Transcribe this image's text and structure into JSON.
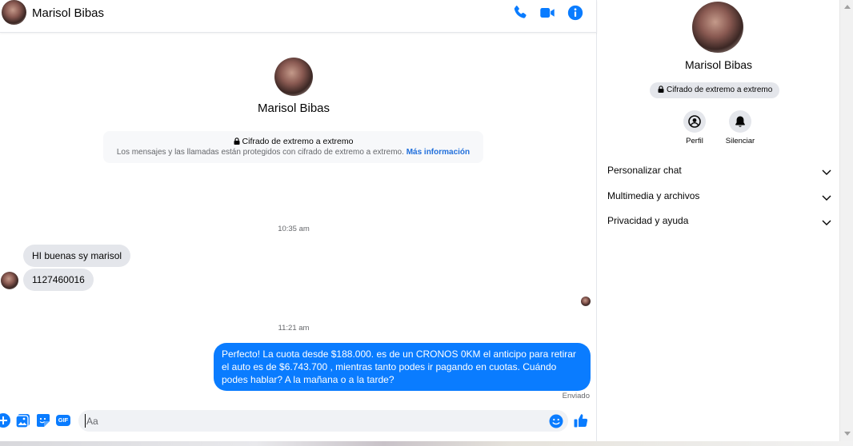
{
  "contact": {
    "name": "Marisol Bibas"
  },
  "header": {
    "icons": [
      "phone-icon",
      "video-camera-icon",
      "info-icon"
    ]
  },
  "intro": {
    "name": "Marisol Bibas",
    "e2ee_title": "Cifrado de extremo a extremo",
    "e2ee_text": "Los mensajes y las llamadas están protegidos con cifrado de extremo a extremo.",
    "e2ee_link": "Más información"
  },
  "messages": {
    "time1": "10:35 am",
    "in1": "HI buenas  sy marisol",
    "in2": "1127460016",
    "time2": "11:21 am",
    "out1": "Perfecto! La cuota desde $188.000. es de un CRONOS 0KM el anticipo para retirar el auto es de $6.743.700 , mientras tanto podes ir pagando en cuotas. Cuándo podes hablar? A la mañana o a la tarde?",
    "status": "Enviado"
  },
  "composer": {
    "placeholder": "Aa",
    "icons": [
      "plus-icon",
      "image-icon",
      "sticker-icon",
      "gif-icon",
      "emoji-icon",
      "thumbs-up-icon"
    ],
    "gif_label": "GIF"
  },
  "info_panel": {
    "name": "Marisol Bibas",
    "e2ee_badge": "Cifrado de extremo a extremo",
    "actions": [
      {
        "label": "Perfil",
        "icon": "profile-icon"
      },
      {
        "label": "Silenciar",
        "icon": "bell-icon"
      }
    ],
    "sections": [
      {
        "label": "Personalizar chat"
      },
      {
        "label": "Multimedia y archivos"
      },
      {
        "label": "Privacidad y ayuda"
      }
    ]
  },
  "colors": {
    "accent": "#0a7cff",
    "incoming_bubble": "#e4e6eb",
    "link": "#216fdb"
  }
}
